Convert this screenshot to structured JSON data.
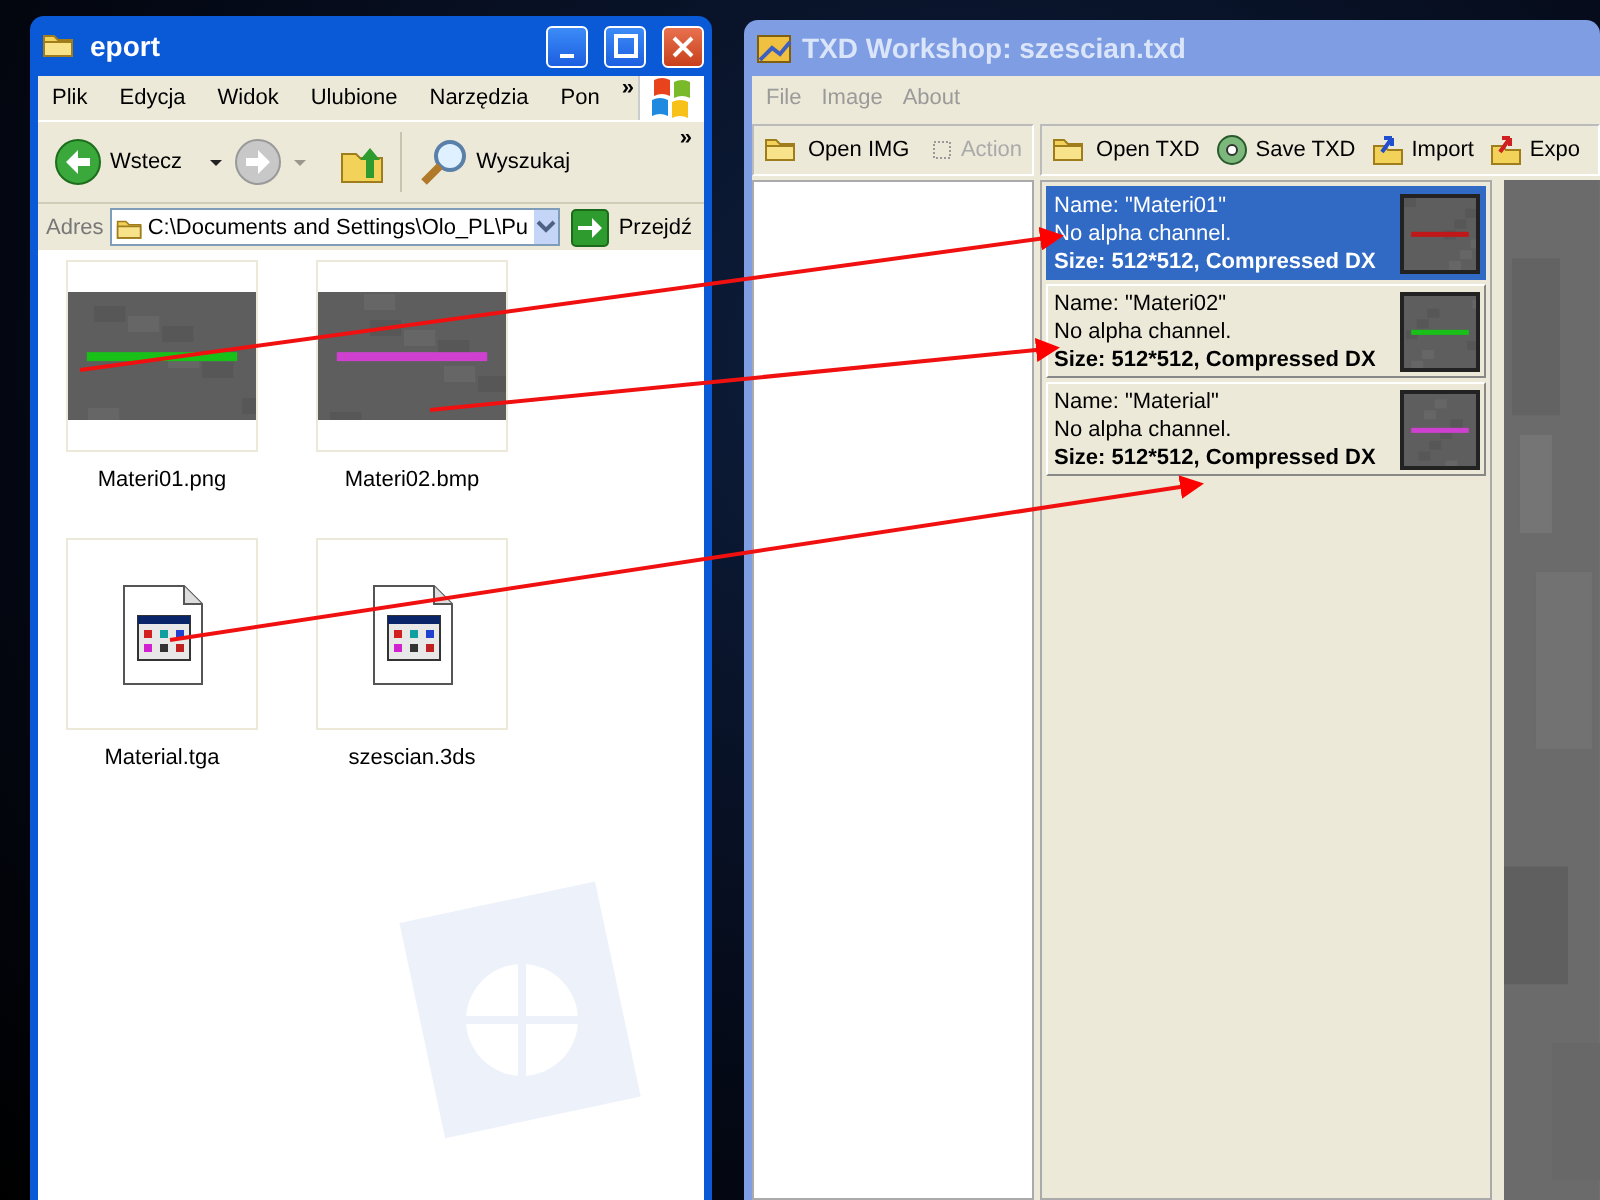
{
  "explorer": {
    "title": "eport",
    "menu": [
      "Plik",
      "Edycja",
      "Widok",
      "Ulubione",
      "Narzędzia",
      "Pon"
    ],
    "menu_more": "»",
    "toolbar": {
      "back": "Wstecz",
      "search": "Wyszukaj",
      "more": "»"
    },
    "address": {
      "label": "Adres",
      "value": "C:\\Documents and Settings\\Olo_PL\\Pu",
      "go": "Przejdź"
    },
    "files": [
      {
        "name": "Materi01.png",
        "kind": "picture"
      },
      {
        "name": "Materi02.bmp",
        "kind": "picture"
      },
      {
        "name": "Material.tga",
        "kind": "document"
      },
      {
        "name": "szescian.3ds",
        "kind": "document"
      }
    ]
  },
  "txd": {
    "title": "TXD Workshop: szescian.txd",
    "menu": [
      "File",
      "Image",
      "About"
    ],
    "left_toolbar": [
      {
        "label": "Open IMG",
        "disabled": false
      },
      {
        "label": "Action",
        "disabled": true
      }
    ],
    "toolbar": [
      "Open TXD",
      "Save TXD",
      "Import",
      "Expo"
    ],
    "textures": [
      {
        "name": "Name: \"Materi01\"",
        "alpha": "No alpha channel.",
        "size": "Size: 512*512, Compressed DX",
        "selected": true
      },
      {
        "name": "Name: \"Materi02\"",
        "alpha": "No alpha channel.",
        "size": "Size: 512*512, Compressed DX",
        "selected": false
      },
      {
        "name": "Name: \"Material\"",
        "alpha": "No alpha channel.",
        "size": "Size: 512*512, Compressed DX",
        "selected": false
      }
    ]
  }
}
